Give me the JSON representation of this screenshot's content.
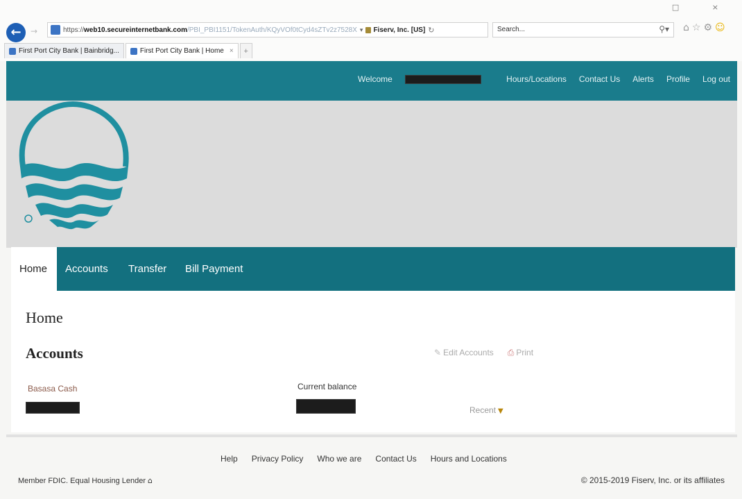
{
  "browser": {
    "address": {
      "scheme": "https://",
      "host": "web10.secureinternetbank.com",
      "path": "/PBI_PBI1151/TokenAuth/KQyVOf0tCyd4sZTv2z7528X",
      "certificate": "Fiserv, Inc. [US]"
    },
    "search_placeholder": "Search...",
    "tabs": [
      {
        "title": "First Port City Bank | Bainbridg..."
      },
      {
        "title": "First Port City Bank | Home"
      }
    ],
    "new_tab_label": "+"
  },
  "topbar": {
    "welcome": "Welcome",
    "links": [
      "Hours/Locations",
      "Contact Us",
      "Alerts",
      "Profile",
      "Log out"
    ]
  },
  "nav": {
    "items": [
      "Home",
      "Accounts",
      "Transfer",
      "Bill Payment"
    ],
    "active": "Home"
  },
  "content": {
    "page_title": "Home",
    "section_title": "Accounts",
    "edit_accounts": "Edit Accounts",
    "print": "Print",
    "account_name": "Basasa Cash",
    "balance_label": "Current balance",
    "recent": "Recent"
  },
  "footer": {
    "links": [
      "Help",
      "Privacy Policy",
      "Who we are",
      "Contact Us",
      "Hours and Locations"
    ],
    "fdic": "Member FDIC. Equal Housing Lender",
    "copyright": "© 2015-2019 Fiserv, Inc. or its affiliates"
  },
  "colors": {
    "topbar": "#1a7c8c",
    "nav": "#13707f",
    "logo": "#1f8fa0"
  }
}
